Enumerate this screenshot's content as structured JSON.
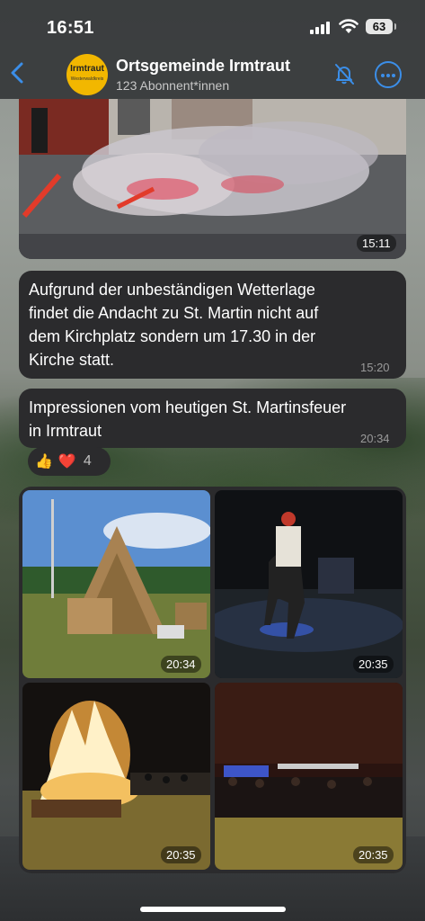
{
  "status": {
    "time": "16:51",
    "battery": "63"
  },
  "header": {
    "title": "Ortsgemeinde Irmtraut",
    "subtitle": "123 Abonnent*innen",
    "avatar_line1": "Irmtraut",
    "avatar_line2": "Westerwaldkreis",
    "accent": "#3b8ee8"
  },
  "messages": [
    {
      "type": "photo",
      "time": "15:11"
    },
    {
      "type": "text",
      "text_lines": [
        "Aufgrund der unbeständigen Wetterlage",
        "findet die Andacht zu St. Martin nicht auf",
        "dem Kirchplatz sondern um 17.30 in der",
        "Kirche statt."
      ],
      "time": "15:20"
    },
    {
      "type": "text",
      "text_lines": [
        "Impressionen vom heutigen St. Martinsfeuer",
        "in Irmtraut"
      ],
      "time": "20:34",
      "reactions": {
        "emoji1": "👍",
        "emoji2": "❤️",
        "count": "4"
      }
    },
    {
      "type": "album",
      "tiles": [
        {
          "time": "20:34",
          "icon": "woodpile-photo"
        },
        {
          "time": "20:35",
          "icon": "rider-photo"
        },
        {
          "time": "20:35",
          "icon": "bonfire-photo"
        },
        {
          "time": "20:35",
          "icon": "crowd-photo"
        }
      ]
    }
  ]
}
